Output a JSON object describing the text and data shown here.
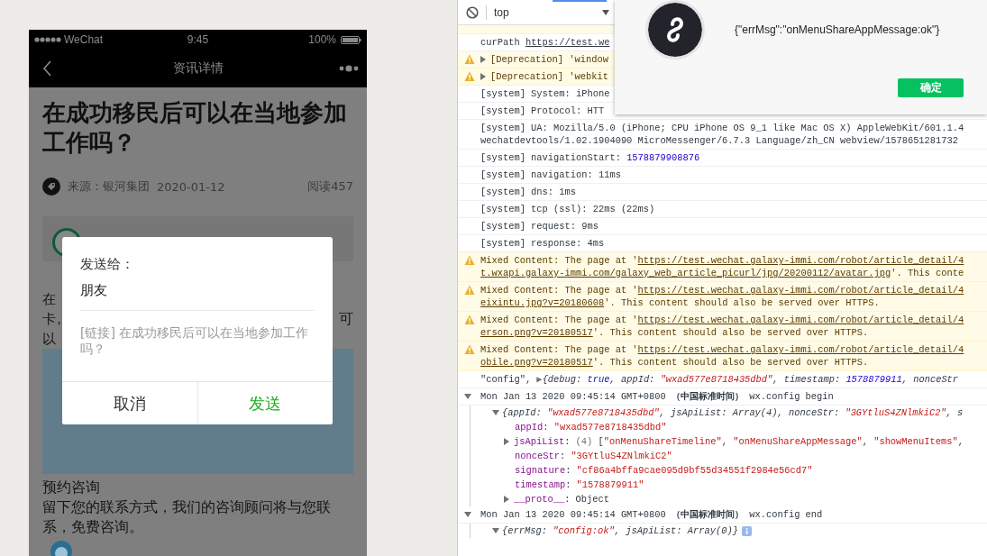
{
  "phone": {
    "status_bar": {
      "carrier": "WeChat",
      "time": "9:45",
      "battery": "100%"
    },
    "nav_bar": {
      "title": "资讯详情"
    },
    "article": {
      "title": "在成功移民后可以在当地参加工作吗？",
      "source": "来源：银河集团",
      "date": "2020-01-12",
      "reads": "阅读457",
      "body_lines": [
        {
          "left": "在"
        },
        {
          "left": "卡，",
          "right": "可"
        },
        {
          "left": "以"
        }
      ],
      "consult_title": "预约咨询",
      "consult_text": "留下您的联系方式，我们的咨询顾问将与您联系，免费咨询。"
    },
    "share_dialog": {
      "label": "发送给：",
      "recipient": "朋友",
      "link_text": "[链接] 在成功移民后可以在当地参加工作吗？",
      "buttons": [
        {
          "label": "取消",
          "kind": "cancel"
        },
        {
          "label": "发送",
          "kind": "confirm"
        }
      ]
    }
  },
  "console": {
    "context": "top",
    "logs": [
      {
        "kind": "log",
        "lines": [
          [
            {
              "kind": "plain",
              "text": "curPath "
            },
            {
              "kind": "link",
              "text": "https://test.we"
            }
          ]
        ]
      },
      {
        "kind": "warning",
        "expanded": false,
        "lines": [
          [
            {
              "kind": "plain",
              "text": "[Deprecation] 'window"
            }
          ]
        ]
      },
      {
        "kind": "warning",
        "expanded": false,
        "lines": [
          [
            {
              "kind": "plain",
              "text": "[Deprecation] 'webkit"
            }
          ]
        ]
      },
      {
        "kind": "log",
        "lines": [
          [
            {
              "kind": "plain",
              "text": "[system] System: iPhone"
            }
          ]
        ]
      },
      {
        "kind": "log",
        "lines": [
          [
            {
              "kind": "plain",
              "text": "[system] Protocol: HTT"
            }
          ]
        ]
      },
      {
        "kind": "log",
        "lines": [
          [
            {
              "kind": "plain",
              "text": "[system] UA: Mozilla/5.0 (iPhone; CPU iPhone OS 9_1 like Mac OS X) AppleWebKit/601.1.4"
            }
          ],
          [
            {
              "kind": "plain",
              "text": "wechatdevtools/1.02.1904090 MicroMessenger/6.7.3 Language/zh_CN webview/1578651281732"
            }
          ]
        ]
      },
      {
        "kind": "log",
        "lines": [
          [
            {
              "kind": "plain",
              "text": "[system] navigationStart: "
            },
            {
              "kind": "number",
              "text": "1578879908876"
            }
          ]
        ]
      },
      {
        "kind": "log",
        "lines": [
          [
            {
              "kind": "plain",
              "text": "[system] navigation: 11ms"
            }
          ]
        ]
      },
      {
        "kind": "log",
        "lines": [
          [
            {
              "kind": "plain",
              "text": "[system] dns: 1ms"
            }
          ]
        ]
      },
      {
        "kind": "log",
        "lines": [
          [
            {
              "kind": "plain",
              "text": "[system] tcp (ssl): 22ms (22ms)"
            }
          ]
        ]
      },
      {
        "kind": "log",
        "lines": [
          [
            {
              "kind": "plain",
              "text": "[system] request: 9ms"
            }
          ]
        ]
      },
      {
        "kind": "log",
        "lines": [
          [
            {
              "kind": "plain",
              "text": "[system] response: 4ms"
            }
          ]
        ]
      },
      {
        "kind": "warning",
        "lines": [
          [
            {
              "kind": "plain",
              "text": "Mixed Content: The page at '"
            },
            {
              "kind": "link",
              "text": "https://test.wechat.galaxy-immi.com/robot/article_detail/4"
            }
          ],
          [
            {
              "kind": "link",
              "text": "t.wxapi.galaxy-immi.com/galaxy_web_article_picurl/jpg/20200112/avatar.jpg"
            },
            {
              "kind": "plain",
              "text": "'. This conte"
            }
          ]
        ]
      },
      {
        "kind": "warning",
        "lines": [
          [
            {
              "kind": "plain",
              "text": "Mixed Content: The page at '"
            },
            {
              "kind": "link",
              "text": "https://test.wechat.galaxy-immi.com/robot/article_detail/4"
            }
          ],
          [
            {
              "kind": "link",
              "text": "eixintu.jpg?v=20180608"
            },
            {
              "kind": "plain",
              "text": "'. This content should also be served over HTTPS."
            }
          ]
        ]
      },
      {
        "kind": "warning",
        "lines": [
          [
            {
              "kind": "plain",
              "text": "Mixed Content: The page at '"
            },
            {
              "kind": "link",
              "text": "https://test.wechat.galaxy-immi.com/robot/article_detail/4"
            }
          ],
          [
            {
              "kind": "link",
              "text": "erson.png?v=20180517"
            },
            {
              "kind": "plain",
              "text": "'. This content should also be served over HTTPS."
            }
          ]
        ]
      },
      {
        "kind": "warning",
        "lines": [
          [
            {
              "kind": "plain",
              "text": "Mixed Content: The page at '"
            },
            {
              "kind": "link",
              "text": "https://test.wechat.galaxy-immi.com/robot/article_detail/4"
            }
          ],
          [
            {
              "kind": "link",
              "text": "obile.png?v=20180517"
            },
            {
              "kind": "plain",
              "text": "'. This content should also be served over HTTPS."
            }
          ]
        ]
      },
      {
        "kind": "log",
        "lines": [
          [
            {
              "kind": "plain",
              "text": "\"config\", "
            },
            {
              "kind": "muted",
              "text": "▶"
            },
            {
              "kind": "plain",
              "italic": true,
              "text": "{debug: "
            },
            {
              "kind": "keyword",
              "italic": true,
              "text": "true"
            },
            {
              "kind": "plain",
              "italic": true,
              "text": ", appId: "
            },
            {
              "kind": "string",
              "italic": true,
              "text": "\"wxad577e8718435dbd\""
            },
            {
              "kind": "plain",
              "italic": true,
              "text": ", timestamp: "
            },
            {
              "kind": "number",
              "italic": true,
              "text": "1578879911"
            },
            {
              "kind": "plain",
              "italic": true,
              "text": ", nonceStr"
            }
          ]
        ]
      },
      {
        "kind": "log",
        "expanded": true,
        "lines": [
          [
            {
              "kind": "plain",
              "text": "Mon Jan 13 2020 09:45:14 GMT+0800 "
            },
            {
              "kind": "bold",
              "text": "（中国标准时间）"
            },
            {
              "kind": "plain",
              "text": " wx.config begin"
            }
          ]
        ],
        "children": [
          {
            "expanded": true,
            "lines": [
              [
                {
                  "kind": "plain",
                  "italic": true,
                  "text": "{appId: "
                },
                {
                  "kind": "string",
                  "italic": true,
                  "text": "\"wxad577e8718435dbd\""
                },
                {
                  "kind": "plain",
                  "italic": true,
                  "text": ", jsApiList: Array(4), nonceStr: "
                },
                {
                  "kind": "string",
                  "italic": true,
                  "text": "\"3GYtluS4ZNlmkiC2\""
                },
                {
                  "kind": "plain",
                  "italic": true,
                  "text": ", s"
                }
              ]
            ],
            "children": [
              {
                "lines": [
                  [
                    {
                      "kind": "key",
                      "text": "appId"
                    },
                    {
                      "kind": "plain",
                      "text": ": "
                    },
                    {
                      "kind": "string",
                      "text": "\"wxad577e8718435dbd\""
                    }
                  ]
                ]
              },
              {
                "expanded": false,
                "lines": [
                  [
                    {
                      "kind": "key",
                      "text": "jsApiList"
                    },
                    {
                      "kind": "plain",
                      "text": ": "
                    },
                    {
                      "kind": "muted",
                      "text": "(4) "
                    },
                    {
                      "kind": "plain",
                      "text": "["
                    },
                    {
                      "kind": "string",
                      "text": "\"onMenuShareTimeline\""
                    },
                    {
                      "kind": "plain",
                      "text": ", "
                    },
                    {
                      "kind": "string",
                      "text": "\"onMenuShareAppMessage\""
                    },
                    {
                      "kind": "plain",
                      "text": ", "
                    },
                    {
                      "kind": "string",
                      "text": "\"showMenuItems\""
                    },
                    {
                      "kind": "plain",
                      "text": ","
                    }
                  ]
                ]
              },
              {
                "lines": [
                  [
                    {
                      "kind": "key",
                      "text": "nonceStr"
                    },
                    {
                      "kind": "plain",
                      "text": ": "
                    },
                    {
                      "kind": "string",
                      "text": "\"3GYtluS4ZNlmkiC2\""
                    }
                  ]
                ]
              },
              {
                "lines": [
                  [
                    {
                      "kind": "key",
                      "text": "signature"
                    },
                    {
                      "kind": "plain",
                      "text": ": "
                    },
                    {
                      "kind": "string",
                      "text": "\"cf86a4bffa9cae095d9bf55d34551f2984e56cd7\""
                    }
                  ]
                ]
              },
              {
                "lines": [
                  [
                    {
                      "kind": "key",
                      "text": "timestamp"
                    },
                    {
                      "kind": "plain",
                      "text": ": "
                    },
                    {
                      "kind": "string",
                      "text": "\"1578879911\""
                    }
                  ]
                ]
              },
              {
                "expanded": false,
                "lines": [
                  [
                    {
                      "kind": "key",
                      "text": "__proto__"
                    },
                    {
                      "kind": "plain",
                      "text": ": Object"
                    }
                  ]
                ]
              }
            ]
          }
        ]
      },
      {
        "kind": "log",
        "expanded": true,
        "lines": [
          [
            {
              "kind": "plain",
              "text": "Mon Jan 13 2020 09:45:14 GMT+0800 "
            },
            {
              "kind": "bold",
              "text": "（中国标准时间）"
            },
            {
              "kind": "plain",
              "text": " wx.config end"
            }
          ]
        ],
        "children": [
          {
            "expanded": true,
            "info": true,
            "lines": [
              [
                {
                  "kind": "plain",
                  "italic": true,
                  "text": "{errMsg: "
                },
                {
                  "kind": "string",
                  "italic": true,
                  "text": "\"config:ok\""
                },
                {
                  "kind": "plain",
                  "italic": true,
                  "text": ", jsApiList: Array(0)}"
                }
              ]
            ]
          }
        ]
      }
    ]
  },
  "alert": {
    "message": "{\"errMsg\":\"onMenuShareAppMessage:ok\"}",
    "button": "确定"
  }
}
